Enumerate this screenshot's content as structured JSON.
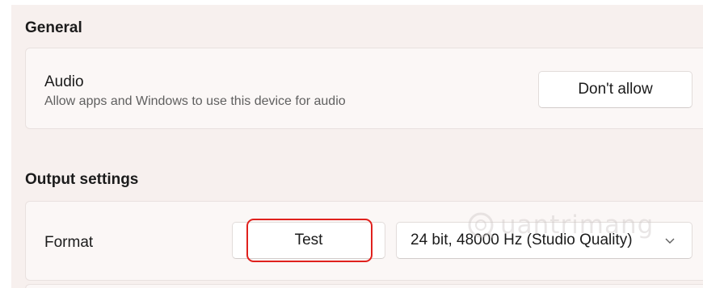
{
  "sections": {
    "general": {
      "title": "General",
      "audio": {
        "title": "Audio",
        "description": "Allow apps and Windows to use this device for audio",
        "button_label": "Don't allow"
      }
    },
    "output": {
      "title": "Output settings",
      "format": {
        "title": "Format",
        "test_label": "Test",
        "selected_format": "24 bit, 48000 Hz (Studio Quality)"
      }
    }
  },
  "watermark": {
    "text": "uantrimang"
  },
  "colors": {
    "highlight": "#e0211d",
    "background": "#f7f0ee",
    "card": "#fbf7f6"
  }
}
